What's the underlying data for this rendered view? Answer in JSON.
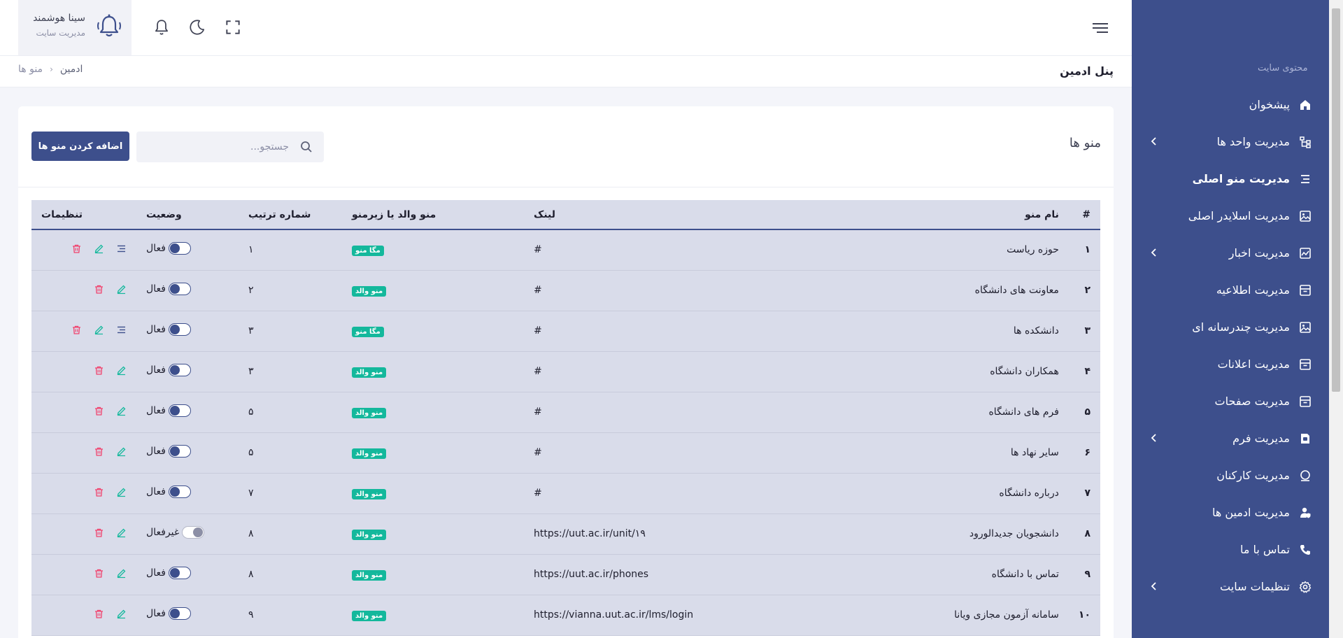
{
  "colors": {
    "primary": "#3d4f8c",
    "sidebar_bg": "#3d4f8c",
    "badge": "#14b89c",
    "danger": "#f1416c",
    "edit": "#14b89c",
    "row_bg": "#d9dcea"
  },
  "user": {
    "name": "سینا هوشمند",
    "role": "مدیریت سایت"
  },
  "header": {
    "page_title": "پنل ادمین",
    "breadcrumb": [
      "ادمین",
      "منو ها"
    ]
  },
  "sidebar": {
    "section_title": "محتوی سایت",
    "items": [
      {
        "label": "پیشخوان",
        "icon": "home-icon",
        "active": false,
        "has_children": false
      },
      {
        "label": "مدیریت واحد ها",
        "icon": "sitemap-icon",
        "active": false,
        "has_children": true
      },
      {
        "label": "مدیریت منو اصلی",
        "icon": "menu-lines-icon",
        "active": true,
        "has_children": false
      },
      {
        "label": "مدیریت اسلایدر اصلی",
        "icon": "image-icon",
        "active": false,
        "has_children": false
      },
      {
        "label": "مدیریت اخبار",
        "icon": "chart-image-icon",
        "active": false,
        "has_children": true
      },
      {
        "label": "مدیریت اطلاعیه",
        "icon": "archive-icon",
        "active": false,
        "has_children": false
      },
      {
        "label": "مدیریت چندرسانه ای",
        "icon": "image-icon",
        "active": false,
        "has_children": false
      },
      {
        "label": "مدیریت اعلانات",
        "icon": "archive-icon",
        "active": false,
        "has_children": false
      },
      {
        "label": "مدیریت صفحات",
        "icon": "archive-icon",
        "active": false,
        "has_children": false
      },
      {
        "label": "مدیریت فرم",
        "icon": "form-icon",
        "active": false,
        "has_children": true
      },
      {
        "label": "مدیریت کارکنان",
        "icon": "user-circle-icon",
        "active": false,
        "has_children": false
      },
      {
        "label": "مدیریت ادمین ها",
        "icon": "user-shield-icon",
        "active": false,
        "has_children": false
      },
      {
        "label": "تماس با ما",
        "icon": "phone-icon",
        "active": false,
        "has_children": false
      },
      {
        "label": "تنظیمات سایت",
        "icon": "gear-icon",
        "active": false,
        "has_children": true
      }
    ]
  },
  "card": {
    "title": "منو ها",
    "search_placeholder": "جستجو...",
    "add_button": "اضافه کردن منو ها"
  },
  "table": {
    "headers": [
      "#",
      "نام منو",
      "لینک",
      "منو والد یا زیرمنو",
      "شماره ترتیب",
      "وضعیت",
      "تنظیمات"
    ],
    "rows": [
      {
        "num": "۱",
        "name": "حوزه ریاست",
        "link": "#",
        "type": "مگا منو",
        "order": "۱",
        "status": "فعال",
        "active": true,
        "submenu": true
      },
      {
        "num": "۲",
        "name": "معاونت های دانشگاه",
        "link": "#",
        "type": "منو والد",
        "order": "۲",
        "status": "فعال",
        "active": true,
        "submenu": false
      },
      {
        "num": "۳",
        "name": "دانشکده ها",
        "link": "#",
        "type": "مگا منو",
        "order": "۳",
        "status": "فعال",
        "active": true,
        "submenu": true
      },
      {
        "num": "۴",
        "name": "همکاران دانشگاه",
        "link": "#",
        "type": "منو والد",
        "order": "۳",
        "status": "فعال",
        "active": true,
        "submenu": false
      },
      {
        "num": "۵",
        "name": "فرم های دانشگاه",
        "link": "#",
        "type": "منو والد",
        "order": "۵",
        "status": "فعال",
        "active": true,
        "submenu": false
      },
      {
        "num": "۶",
        "name": "سایر نهاد ها",
        "link": "#",
        "type": "منو والد",
        "order": "۵",
        "status": "فعال",
        "active": true,
        "submenu": false
      },
      {
        "num": "۷",
        "name": "درباره دانشگاه",
        "link": "#",
        "type": "منو والد",
        "order": "۷",
        "status": "فعال",
        "active": true,
        "submenu": false
      },
      {
        "num": "۸",
        "name": "دانشجویان جدیدالورود",
        "link": "https://uut.ac.ir/unit/۱۹",
        "type": "منو والد",
        "order": "۸",
        "status": "غیرفعال",
        "active": false,
        "submenu": false
      },
      {
        "num": "۹",
        "name": "تماس با دانشگاه",
        "link": "https://uut.ac.ir/phones",
        "type": "منو والد",
        "order": "۸",
        "status": "فعال",
        "active": true,
        "submenu": false
      },
      {
        "num": "۱۰",
        "name": "سامانه آزمون مجازی ویانا",
        "link": "https://vianna.uut.ac.ir/lms/login",
        "type": "منو والد",
        "order": "۹",
        "status": "فعال",
        "active": true,
        "submenu": false
      }
    ]
  }
}
